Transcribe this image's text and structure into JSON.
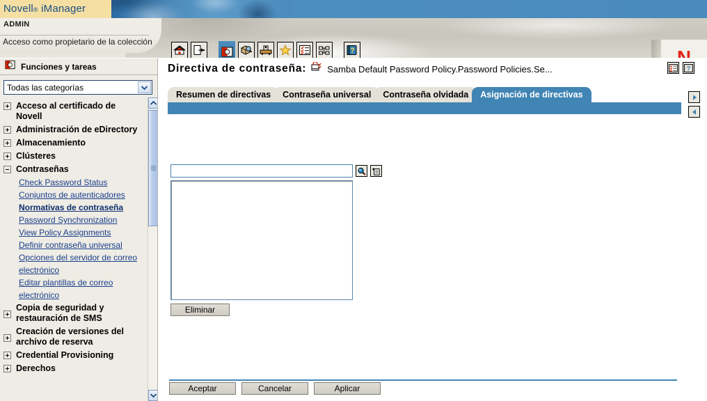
{
  "banner": {
    "product_name": "Novell",
    "product_reg": "®",
    "product_suffix": "iManager",
    "brand_mark": "N",
    "brand_color": "#e2231a",
    "accent_blue": "#4185b4",
    "banner_blue": "#4a8abd",
    "header_beige": "#f5dfa2"
  },
  "header": {
    "user": "ADMIN",
    "access_text": "Acceso como propietario de la colección"
  },
  "toolbar": {
    "items": [
      {
        "name": "home-icon",
        "title": "Inicio"
      },
      {
        "name": "exit-icon",
        "title": "Salir"
      },
      {
        "name": "roles-and-tasks-icon",
        "title": "Funciones y tareas",
        "selected": true
      },
      {
        "name": "object-view-icon",
        "title": "Ver objetos"
      },
      {
        "name": "configure-icon",
        "title": "Configurar"
      },
      {
        "name": "favorites-star-icon",
        "title": "Favoritos"
      },
      {
        "name": "preferences-list-icon",
        "title": "Preferencias"
      },
      {
        "name": "network-objects-icon",
        "title": "Objetos de red"
      },
      {
        "name": "help-book-icon",
        "title": "Ayuda"
      }
    ]
  },
  "sidebar": {
    "title": "Funciones y tareas",
    "title_icon": "roles-and-tasks-icon",
    "category_select": {
      "value": "Todas las categorías",
      "placeholder": "Todas las categorías"
    },
    "tree": [
      {
        "label": "Acceso al certificado de Novell",
        "expanded": false
      },
      {
        "label": "Administración de eDirectory",
        "expanded": false
      },
      {
        "label": "Almacenamiento",
        "expanded": false
      },
      {
        "label": "Clústeres",
        "expanded": false
      },
      {
        "label": "Contraseñas",
        "expanded": true,
        "links": [
          {
            "label": "Check Password Status",
            "current": false
          },
          {
            "label": "Conjuntos de autenticadores",
            "current": false
          },
          {
            "label": "Normativas de contraseña",
            "current": true
          },
          {
            "label": "Password Synchronization",
            "current": false
          },
          {
            "label": "View Policy Assignments",
            "current": false
          },
          {
            "label": "Definir contraseña universal",
            "current": false
          },
          {
            "label": "Opciones del servidor de correo electrónico",
            "current": false
          },
          {
            "label": "Editar plantillas de correo electrónico",
            "current": false
          }
        ]
      },
      {
        "label": "Copia de seguridad y restauración de SMS",
        "expanded": false
      },
      {
        "label": "Creación de versiones del archivo de reserva",
        "expanded": false
      },
      {
        "label": "Credential Provisioning",
        "expanded": false
      },
      {
        "label": "Derechos",
        "expanded": false
      }
    ],
    "scrollbar": {
      "up_icon": "chevron-up-icon",
      "down_icon": "chevron-down-icon",
      "thumb_name": "scroll-thumb"
    }
  },
  "content": {
    "title_label": "Directiva de contraseña:",
    "title_icon": "password-policy-icon",
    "object_name": "Samba Default Password Policy.Password Policies.Se...",
    "title_buttons": [
      {
        "name": "object-details-icon",
        "title": "Detalles"
      },
      {
        "name": "help-question-icon",
        "title": "Ayuda"
      }
    ],
    "tabs": [
      {
        "label": "Resumen de directivas",
        "active": false
      },
      {
        "label": "Contraseña universal",
        "active": false
      },
      {
        "label": "Contraseña olvidada",
        "active": false
      },
      {
        "label": "Asignación de directivas",
        "active": true
      }
    ],
    "nav_next": {
      "name": "nav-next-icon",
      "glyph": "▶"
    },
    "nav_prev": {
      "name": "nav-prev-icon",
      "glyph": "◀"
    },
    "search": {
      "value": "",
      "placeholder": "",
      "buttons": [
        {
          "name": "object-search-icon",
          "title": "Buscar objeto"
        },
        {
          "name": "object-history-icon",
          "title": "Historial de objetos"
        }
      ]
    },
    "assignment_list": {
      "items": []
    },
    "remove_button": "Eliminar",
    "footer_buttons": [
      {
        "label": "Aceptar",
        "name": "accept-button"
      },
      {
        "label": "Cancelar",
        "name": "cancel-button"
      },
      {
        "label": "Aplicar",
        "name": "apply-button"
      }
    ]
  }
}
